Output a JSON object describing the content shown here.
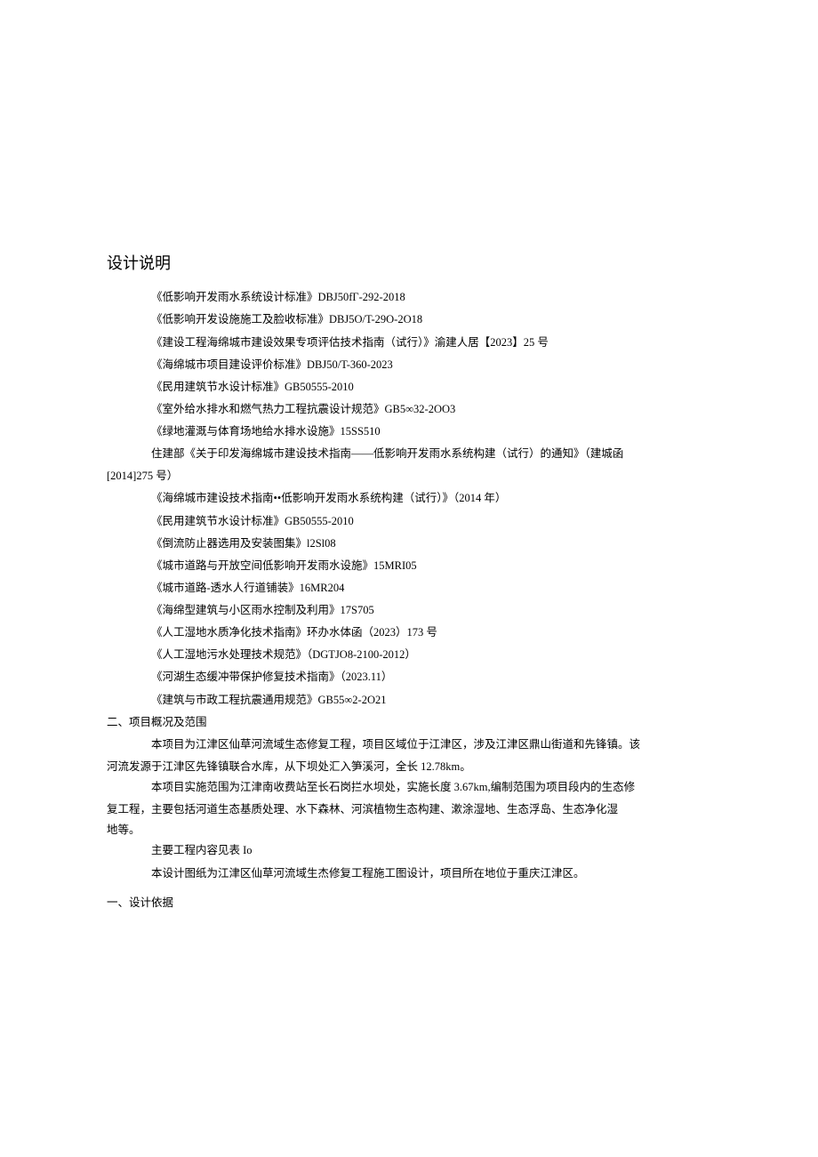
{
  "title": "设计说明",
  "standards": [
    "《低影响开发雨水系统设计标准》DBJ50fГ-292-2018",
    "《低影响开发设施施工及脸收标准》DBJ5O/T-29O-2O18",
    "《建设工程海绵城市建设效果专项评估技术指南（试行）》渝建人居【2023】25 号",
    "《海绵城市项目建设评价标准》DBJ50/T-360-2023",
    "《民用建筑节水设计标准》GB50555-2010",
    "《室外给水排水和燃气热力工程抗震设计规范》GB5∞32-2OO3",
    "《绿地灌溉与体育场地给水排水设施》15SS510"
  ],
  "multiline1_part1": "住建部《关于印发海绵城市建设技术指南——低影响开发雨水系统构建（试行）的通知》（建城函",
  "multiline1_part2": "[2014]275 号）",
  "standards2": [
    "《海绵城市建设技术指南••低影响开发雨水系统构建（试行）》（2014 年）",
    "《民用建筑节水设计标准》GB50555-2010",
    "《倒流防止器选用及安装图集》l2Sl08",
    "《城市道路与开放空间低影响开发雨水设施》15MRI05",
    "《城市道路-透水人行道铺装》16MR204",
    "《海绵型建筑与小区雨水控制及利用》17S705",
    "《人工湿地水质净化技术指南》环办水体函（2023）173 号",
    "《人工湿地污水处理技术规范》（DGTJO8-2100-2012）",
    "《河湖生态缓冲带保护修复技术指南》（2023.11）",
    "《建筑与市政工程抗震通用规范》GB55∞2-2O21"
  ],
  "section2_heading": "二、项目概况及范围",
  "section2_p1a": "本项目为江津区仙草河流域生态修复工程，项目区域位于江津区，涉及江津区鼎山街道和先锋镇。该",
  "section2_p1b": "河流发源于江津区先锋镇联合水库，从下坝处汇入笋溪河，全长 12.78km。",
  "section2_p2a": "本项目实施范围为江津南收费站至长石岗拦水坝处，实施长度 3.67km,编制范围为项目段内的生态修",
  "section2_p2b": "复工程，主要包括河道生态基质处理、水下森林、河滨植物生态构建、漱涂湿地、生态浮岛、生态净化湿",
  "section2_p2c": "地等。",
  "section2_p3": "主要工程内容见表 Io",
  "section2_p4": "本设计图纸为江津区仙草河流域生杰修复工程施工图设计，项目所在地位于重庆江津区。",
  "section1_heading": "一、设计依据"
}
